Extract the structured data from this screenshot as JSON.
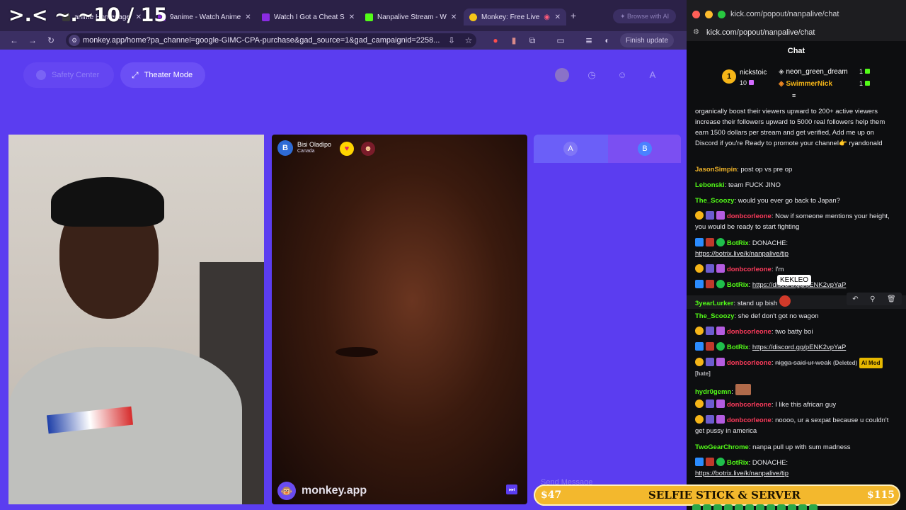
{
  "overlay_counter": ">.< ~.~10 / 15",
  "tabs": [
    {
      "label": "anime Homepage",
      "color": "#3a3a3a"
    },
    {
      "label": "9anime - Watch Anime",
      "color": "#8a2be2"
    },
    {
      "label": "Watch I Got a Cheat S",
      "color": "#8a2be2"
    },
    {
      "label": "Nanpalive Stream - W",
      "color": "#53fc18"
    },
    {
      "label": "Monkey: Free Live",
      "color": "#f5c518"
    }
  ],
  "browse_with_ai": "Browse with AI",
  "address": "monkey.app/home?pa_channel=google-GIMC-CPA-purchase&gad_source=1&gad_campaignid=2258...",
  "finish_update": "Finish update",
  "monkey": {
    "safety_center": "Safety Center",
    "theater_mode": "Theater Mode",
    "peer_initial": "B",
    "peer_name": "Bisi Oladipo",
    "peer_country": "Canada",
    "logo_text": "monkey.app",
    "btn_a": "A",
    "btn_b": "B",
    "profile_initial": "A",
    "send_message": "Send Message"
  },
  "chat": {
    "window_title": "kick.com/popout/nanpalive/chat",
    "url": "kick.com/popout/nanpalive/chat",
    "header": "Chat",
    "leaderboard": [
      {
        "rank": "1",
        "name": "nickstoic",
        "count": "10"
      },
      {
        "name": "neon_green_dream",
        "count": "1"
      },
      {
        "name": "SwimmerNick",
        "count": "1"
      }
    ],
    "messages": [
      {
        "text": "organically boost their viewers upward to 200+ active viewers increase their followers upward to 5000 real followers help them earn 1500 dollars per stream and get verified, Add me up on Discord if you're Ready to promote your channel👉 ryandonald"
      },
      {
        "user": "JasonSimpin",
        "color": "#f0b429",
        "text": "post op vs pre op"
      },
      {
        "user": "Lebonski",
        "color": "#53fc18",
        "text": "team FUCK JINO"
      },
      {
        "user": "The_Scoozy",
        "color": "#53fc18",
        "text": "would you ever go back to Japan?"
      },
      {
        "user": "donbcorleone",
        "color": "#ff3b5c",
        "text": "Now if someone mentions your height, you would be ready to start fighting"
      },
      {
        "user": "BotRix",
        "color": "#53fc18",
        "text": "DONACHE:",
        "link": "https://botrix.live/k/nanpalive/tip"
      },
      {
        "user": "donbcorleone",
        "color": "#ff3b5c",
        "text": "I'm"
      },
      {
        "user": "BotRix",
        "color": "#53fc18",
        "link": "https://discord.gg/pENK2vpYaP"
      },
      {
        "user": "3yearLurker",
        "color": "#53fc18",
        "text": "stand up bish"
      },
      {
        "user": "The_Scoozy",
        "color": "#53fc18",
        "text": "she def don't got no wagon"
      },
      {
        "user": "donbcorleone",
        "color": "#ff3b5c",
        "text": "two batty boi"
      },
      {
        "user": "BotRix",
        "color": "#53fc18",
        "link": "https://discord.gg/pENK2vpYaP"
      },
      {
        "user": "donbcorleone",
        "color": "#ff3b5c",
        "deleted": "nigga said ur weak",
        "deleted_tag": "(Deleted)",
        "mod_tag": "AI Mod",
        "reason": "[hate]"
      },
      {
        "user": "hydr0gemn",
        "color": "#53fc18"
      },
      {
        "user": "donbcorleone",
        "color": "#ff3b5c",
        "text": "I like this african guy"
      },
      {
        "user": "donbcorleone",
        "color": "#ff3b5c",
        "text": "noooo, ur a sexpat because u couldn't get pussy in america"
      },
      {
        "user": "TwoGearChrome",
        "color": "#53fc18",
        "text": "nanpa pull up with sum madness"
      },
      {
        "user": "BotRix",
        "color": "#53fc18",
        "text": "DONACHE:",
        "link": "https://botrix.live/k/nanpalive/tip"
      }
    ],
    "tooltip": "KEKLEO"
  },
  "promo": {
    "left_price": "$47",
    "title": "SELFIE STICK & SERVER",
    "right_price": "$115"
  }
}
